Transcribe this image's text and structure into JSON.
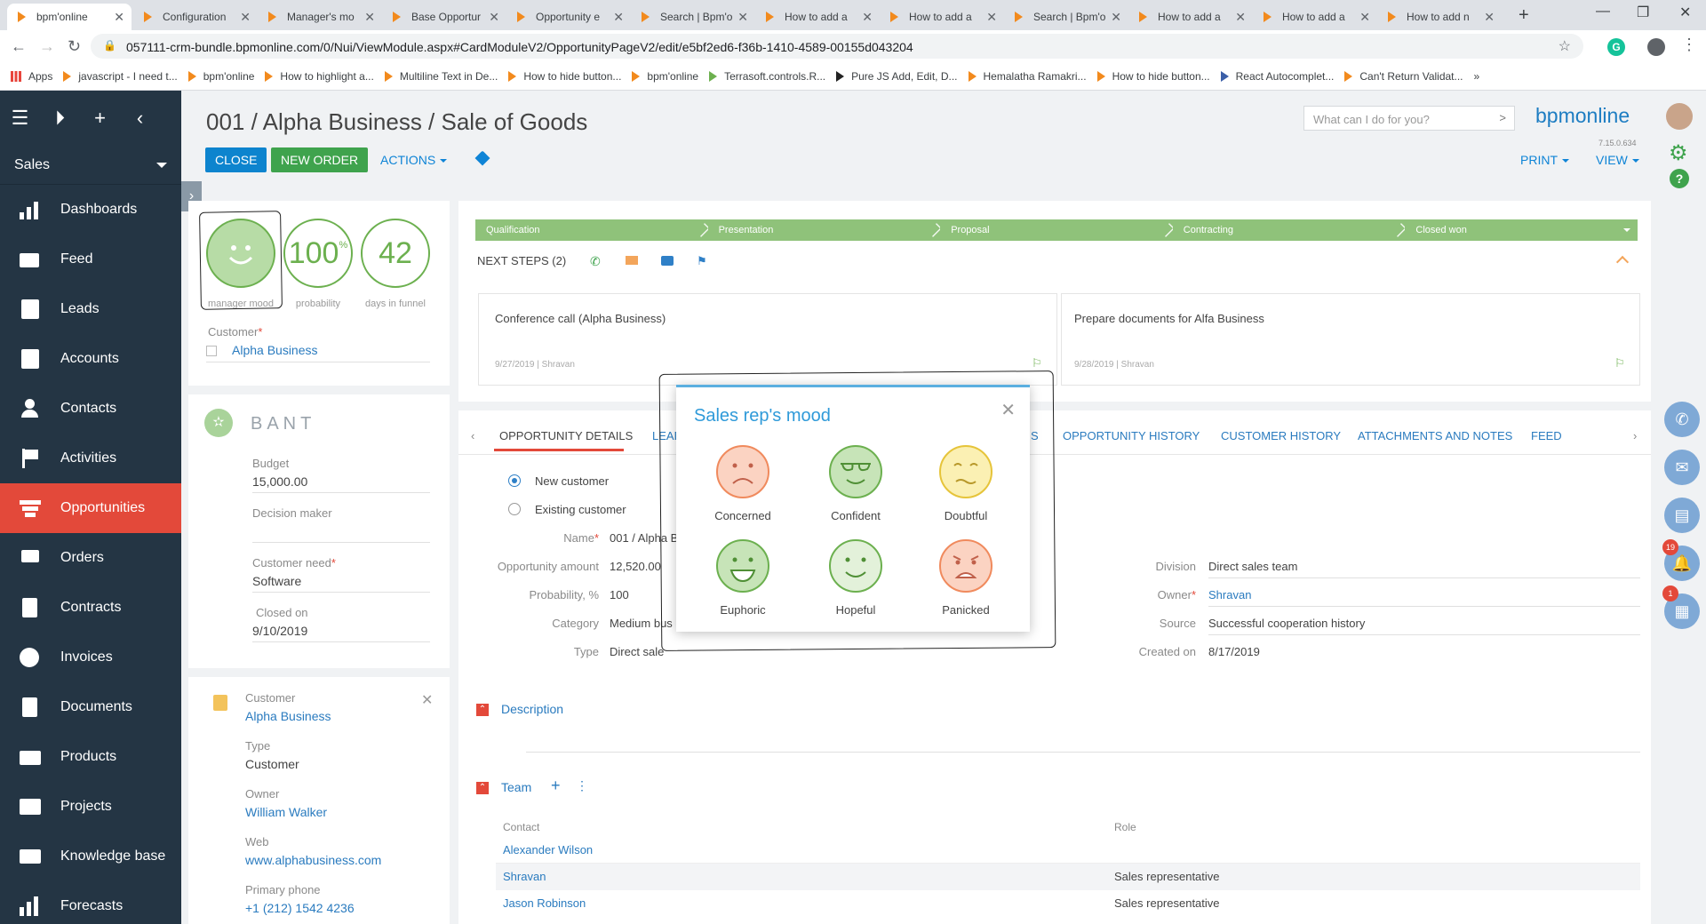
{
  "browser": {
    "tabs": [
      {
        "label": "bpm'online",
        "active": true
      },
      {
        "label": "Configuration"
      },
      {
        "label": "Manager's mo"
      },
      {
        "label": "Base Opportur"
      },
      {
        "label": "Opportunity e"
      },
      {
        "label": "Search | Bpm'o"
      },
      {
        "label": "How to add a"
      },
      {
        "label": "How to add a"
      },
      {
        "label": "Search | Bpm'o"
      },
      {
        "label": "How to add a"
      },
      {
        "label": "How to add a"
      },
      {
        "label": "How to add n"
      }
    ],
    "url": "057111-crm-bundle.bpmonline.com/0/Nui/ViewModule.aspx#CardModuleV2/OpportunityPageV2/edit/e5bf2ed6-f36b-1410-4589-00155d043204",
    "bookmarks": [
      "Apps",
      "javascript - I need t...",
      "bpm'online",
      "How to highlight a...",
      "Multiline Text in De...",
      "How to hide button...",
      "bpm'online",
      "Terrasoft.controls.R...",
      "Pure JS Add, Edit, D...",
      "Hemalatha Ramakri...",
      "How to hide button...",
      "React Autocomplet...",
      "Can't Return Validat..."
    ]
  },
  "nav": {
    "workspace": "Sales",
    "items": [
      {
        "label": "Dashboards"
      },
      {
        "label": "Feed"
      },
      {
        "label": "Leads"
      },
      {
        "label": "Accounts"
      },
      {
        "label": "Contacts"
      },
      {
        "label": "Activities"
      },
      {
        "label": "Opportunities",
        "active": true
      },
      {
        "label": "Orders"
      },
      {
        "label": "Contracts"
      },
      {
        "label": "Invoices"
      },
      {
        "label": "Documents"
      },
      {
        "label": "Products"
      },
      {
        "label": "Projects"
      },
      {
        "label": "Knowledge base"
      },
      {
        "label": "Forecasts"
      }
    ]
  },
  "header": {
    "title": "001 / Alpha Business / Sale of Goods",
    "close": "CLOSE",
    "new_order": "NEW ORDER",
    "actions": "ACTIONS",
    "command_placeholder": "What can I do for you?",
    "brand": "bpmonline",
    "version": "7.15.0.634",
    "print": "PRINT",
    "view": "VIEW"
  },
  "metrics": {
    "mood_label": "manager mood",
    "probability_value": "100",
    "probability_unit": "%",
    "probability_label": "probability",
    "days_value": "42",
    "days_label": "days in funnel",
    "customer_label": "Customer",
    "customer_value": "Alpha Business"
  },
  "bant": {
    "title": "BANT",
    "budget_label": "Budget",
    "budget_value": "15,000.00",
    "decision_label": "Decision maker",
    "need_label": "Customer need",
    "need_value": "Software",
    "closed_label": "Closed on",
    "closed_value": "9/10/2019"
  },
  "customer_card": {
    "customer_label": "Customer",
    "customer_value": "Alpha Business",
    "type_label": "Type",
    "type_value": "Customer",
    "owner_label": "Owner",
    "owner_value": "William Walker",
    "web_label": "Web",
    "web_value": "www.alphabusiness.com",
    "phone_label": "Primary phone",
    "phone_value": "+1 (212) 1542 4236"
  },
  "stages": [
    "Qualification",
    "Presentation",
    "Proposal",
    "Contracting",
    "Closed won"
  ],
  "next_steps": {
    "title": "NEXT STEPS (2)",
    "items": [
      {
        "title": "Conference call (Alpha Business)",
        "date": "9/27/2019",
        "owner": "Shravan"
      },
      {
        "title": "Prepare documents for Alfa Business",
        "date": "9/28/2019",
        "owner": "Shravan"
      }
    ]
  },
  "detail_tabs": [
    "OPPORTUNITY DETAILS",
    "LEAD",
    "S",
    "OPPORTUNITY HISTORY",
    "CUSTOMER HISTORY",
    "ATTACHMENTS AND NOTES",
    "FEED"
  ],
  "details": {
    "new_customer": "New customer",
    "existing_customer": "Existing customer",
    "name_label": "Name",
    "name_value": "001 / Alpha B",
    "amount_label": "Opportunity amount",
    "amount_value": "12,520.00",
    "probability_label": "Probability, %",
    "probability_value": "100",
    "category_label": "Category",
    "category_value": "Medium bus",
    "type_label": "Type",
    "type_value": "Direct sale",
    "division_label": "Division",
    "division_value": "Direct sales team",
    "owner_label": "Owner",
    "owner_value": "Shravan",
    "source_label": "Source",
    "source_value": "Successful cooperation history",
    "created_label": "Created on",
    "created_value": "8/17/2019",
    "description": "Description",
    "team": "Team",
    "team_contact_col": "Contact",
    "team_role_col": "Role",
    "team_rows": [
      {
        "contact": "Alexander Wilson",
        "role": ""
      },
      {
        "contact": "Shravan",
        "role": "Sales representative"
      },
      {
        "contact": "Jason Robinson",
        "role": "Sales representative"
      }
    ]
  },
  "dialog": {
    "title": "Sales rep's mood",
    "moods": [
      {
        "label": "Concerned",
        "color": "#f08a5d",
        "fill": "#fbd3c2"
      },
      {
        "label": "Confident",
        "color": "#6cb04f",
        "fill": "#c7e4b8"
      },
      {
        "label": "Doubtful",
        "color": "#e6c43a",
        "fill": "#fbf0b3"
      },
      {
        "label": "Euphoric",
        "color": "#6cb04f",
        "fill": "#c7e4b8"
      },
      {
        "label": "Hopeful",
        "color": "#6cb04f",
        "fill": "#e3f1da"
      },
      {
        "label": "Panicked",
        "color": "#f08a5d",
        "fill": "#fbd3c2"
      }
    ]
  },
  "right_panel": {
    "notifications_badge": "19",
    "tasks_badge": "1"
  }
}
